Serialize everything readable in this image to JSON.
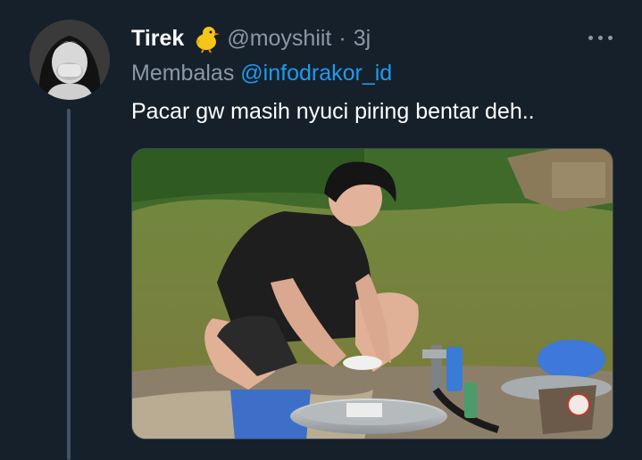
{
  "tweet": {
    "display_name": "Tirek",
    "name_emoji": "chick-emoji",
    "handle": "@moyshiit",
    "separator": "·",
    "time": "3j",
    "reply_prefix": "Membalas",
    "reply_target": "@infodrakor_id",
    "text": "Pacar gw masih nyuci piring bentar deh..",
    "more_icon": "more-options-icon",
    "avatar_icon": "avatar-image",
    "media_icon": "photo-man-washing-dishes"
  },
  "colors": {
    "background": "#15202b",
    "primary_text": "#ffffff",
    "secondary_text": "#8b98a5",
    "link": "#1d9bf0",
    "thread_line": "#3d5466"
  }
}
